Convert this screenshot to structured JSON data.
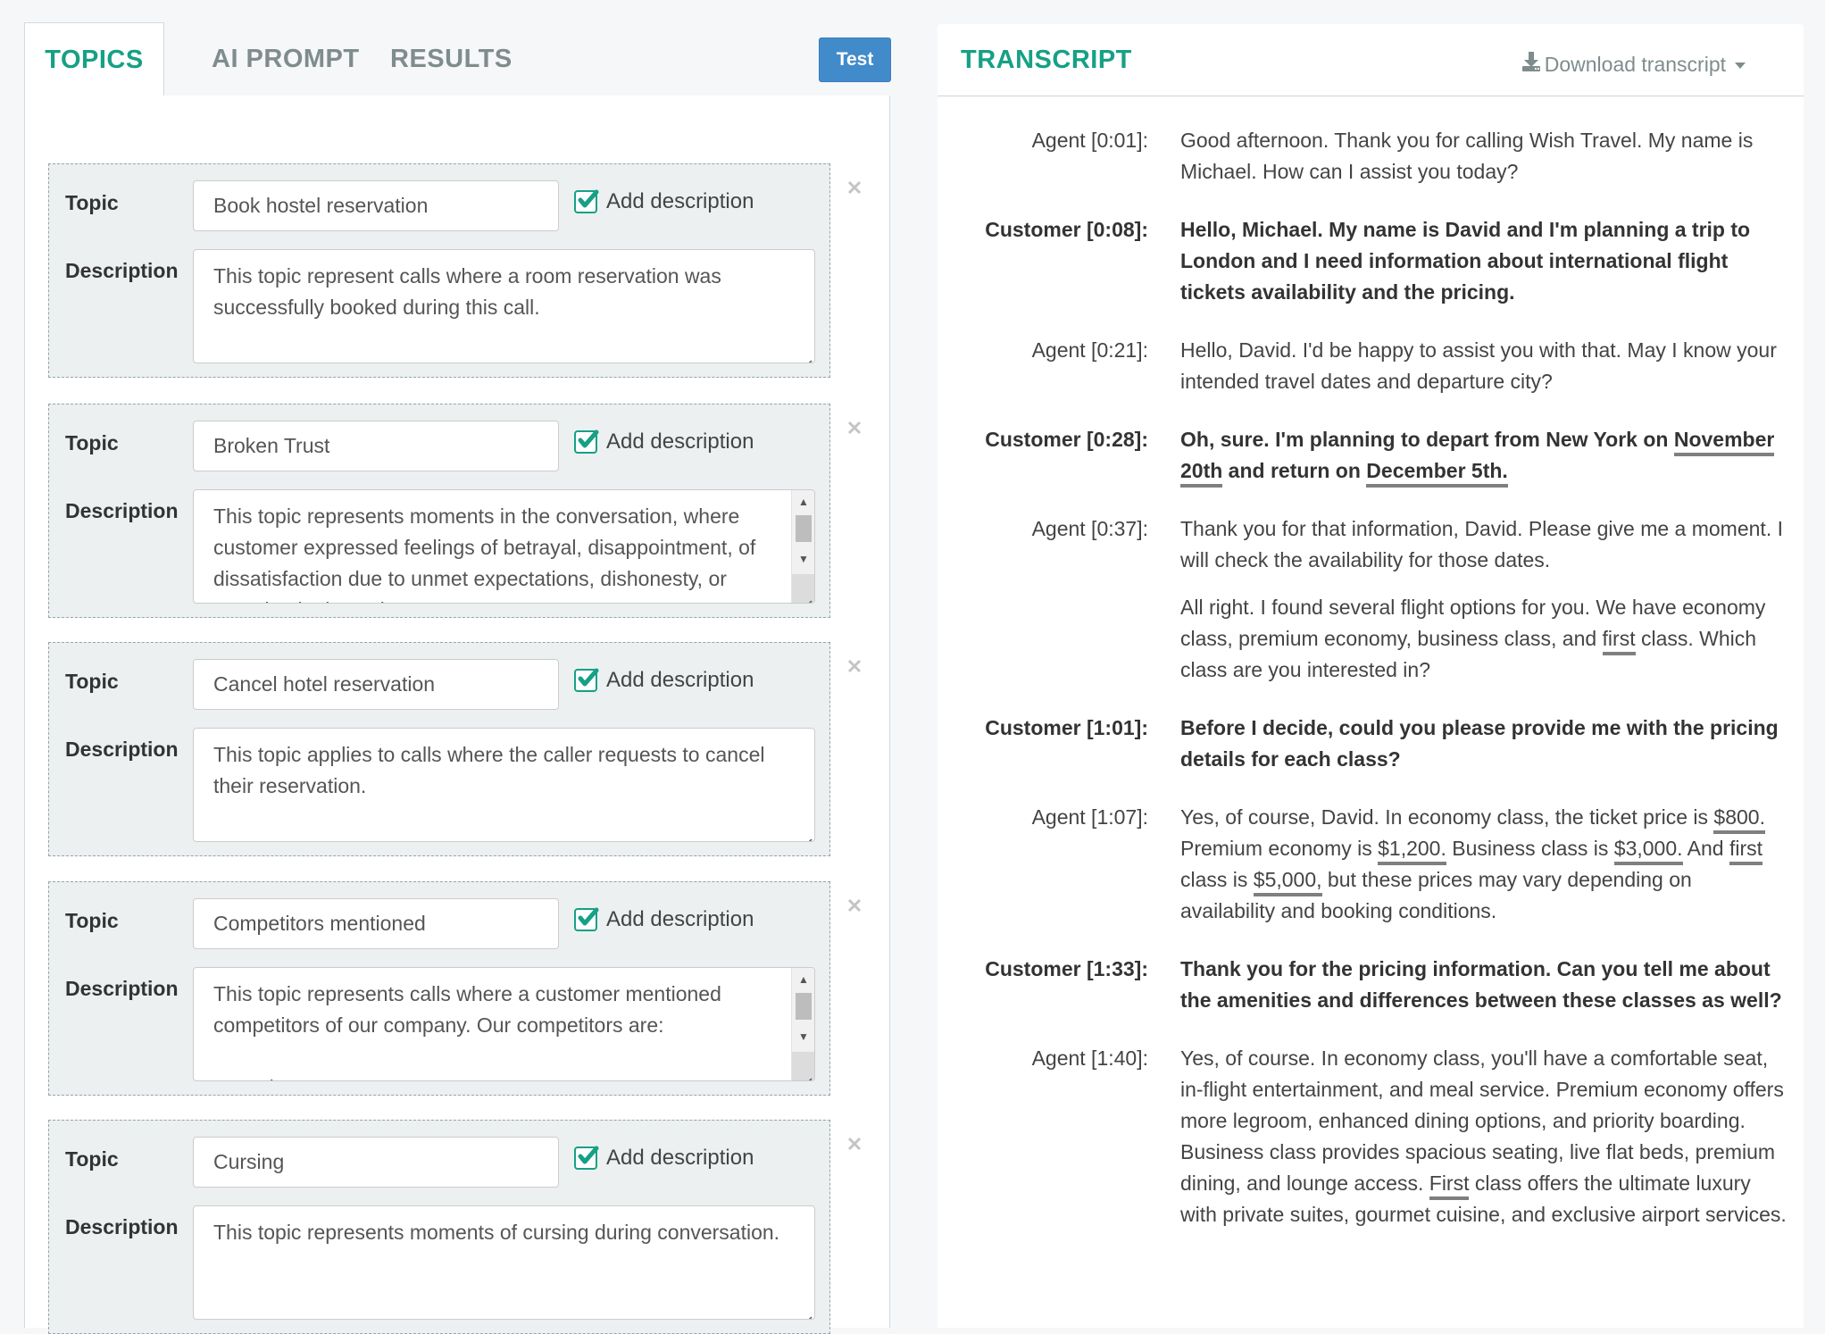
{
  "left_tabs": [
    {
      "label": "TOPICS",
      "active": true
    },
    {
      "label": "AI PROMPT",
      "active": false
    },
    {
      "label": "RESULTS",
      "active": false
    }
  ],
  "test_button": "Test",
  "field_labels": {
    "topic": "Topic",
    "description": "Description",
    "add_description": "Add description"
  },
  "topics": [
    {
      "name": "Book hostel reservation",
      "add_description_checked": true,
      "description": "This topic represent calls where a room reservation was successfully booked during this call.",
      "scrollable": false
    },
    {
      "name": "Broken Trust",
      "add_description_checked": true,
      "description": "This topic represents moments in the conversation, where customer expressed feelings of betrayal, disappointment, of dissatisfaction due to unmet expectations, dishonesty, or perceived misconduct.",
      "scrollable": true
    },
    {
      "name": "Cancel hotel reservation",
      "add_description_checked": true,
      "description": "This topic applies to calls where the caller requests to cancel their reservation.",
      "scrollable": false
    },
    {
      "name": "Competitors mentioned",
      "add_description_checked": true,
      "description": "This topic represents calls where a customer mentioned competitors of our company. Our competitors are:\n\n- Hotel Go",
      "scrollable": true
    },
    {
      "name": "Cursing",
      "add_description_checked": true,
      "description": "This topic represents moments of cursing during conversation.",
      "scrollable": false
    }
  ],
  "transcript": {
    "title": "TRANSCRIPT",
    "download_label": "Download transcript",
    "turns": [
      {
        "speaker": "Agent [0:01]:",
        "role": "agent",
        "paragraphs": [
          [
            {
              "t": "Good afternoon. Thank you for calling Wish Travel. My name is Michael. How can I assist you today?"
            }
          ]
        ]
      },
      {
        "speaker": "Customer [0:08]:",
        "role": "customer",
        "paragraphs": [
          [
            {
              "t": "Hello, Michael. My name is David and I'm planning a trip to London and I need information about international flight tickets availability and the pricing."
            }
          ]
        ]
      },
      {
        "speaker": "Agent [0:21]:",
        "role": "agent",
        "paragraphs": [
          [
            {
              "t": "Hello, David. I'd be happy to assist you with that. May I know your intended travel dates and departure city?"
            }
          ]
        ]
      },
      {
        "speaker": "Customer [0:28]:",
        "role": "customer",
        "paragraphs": [
          [
            {
              "t": "Oh, sure. I'm planning to depart from New York on "
            },
            {
              "t": "November 20th",
              "hl": true
            },
            {
              "t": " and return on "
            },
            {
              "t": "December 5th.",
              "hl": true
            }
          ]
        ]
      },
      {
        "speaker": "Agent [0:37]:",
        "role": "agent",
        "paragraphs": [
          [
            {
              "t": "Thank you for that information, David. Please give me a moment. I will check the availability for those dates."
            }
          ],
          [
            {
              "t": "All right. I found several flight options for you. We have economy class, premium economy, business class, and "
            },
            {
              "t": "first",
              "hl": true
            },
            {
              "t": " class. Which class are you interested in?"
            }
          ]
        ]
      },
      {
        "speaker": "Customer [1:01]:",
        "role": "customer",
        "paragraphs": [
          [
            {
              "t": "Before I decide, could you please provide me with the pricing details for each class?"
            }
          ]
        ]
      },
      {
        "speaker": "Agent [1:07]:",
        "role": "agent",
        "paragraphs": [
          [
            {
              "t": "Yes, of course, David. In economy class, the ticket price is "
            },
            {
              "t": "$800.",
              "hl": true
            },
            {
              "t": " Premium economy is "
            },
            {
              "t": "$1,200.",
              "hl": true
            },
            {
              "t": " Business class is "
            },
            {
              "t": "$3,000.",
              "hl": true
            },
            {
              "t": " And "
            },
            {
              "t": "first",
              "hl": true
            },
            {
              "t": " class is "
            },
            {
              "t": "$5,000,",
              "hl": true
            },
            {
              "t": " but these prices may vary depending on availability and booking conditions."
            }
          ]
        ]
      },
      {
        "speaker": "Customer [1:33]:",
        "role": "customer",
        "paragraphs": [
          [
            {
              "t": "Thank you for the pricing information. Can you tell me about the amenities and differences between these classes as well?"
            }
          ]
        ]
      },
      {
        "speaker": "Agent [1:40]:",
        "role": "agent",
        "paragraphs": [
          [
            {
              "t": "Yes, of course. In economy class, you'll have a comfortable seat, in-flight entertainment, and meal service. Premium economy offers more legroom, enhanced dining options, and priority boarding. Business class provides spacious seating, live flat beds, premium dining, and lounge access. "
            },
            {
              "t": "First",
              "hl": true
            },
            {
              "t": " class offers the ultimate luxury with private suites, gourmet cuisine, and exclusive airport services."
            }
          ]
        ]
      }
    ]
  },
  "colors": {
    "accent": "#16a085",
    "button": "#428bca",
    "muted": "#7f8c8d",
    "highlight_underline": "#7f7f7f"
  },
  "icons": {
    "check": "checkbox-checked-icon",
    "remove": "close-icon",
    "download": "download-icon",
    "caret": "caret-down-icon"
  }
}
